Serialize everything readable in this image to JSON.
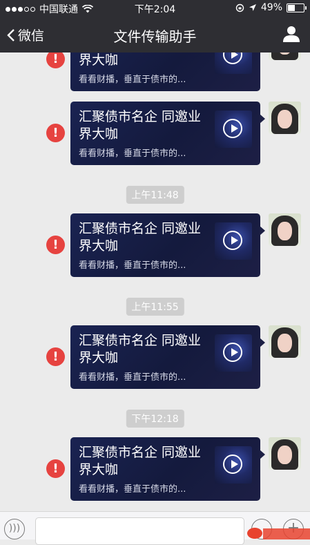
{
  "status_bar": {
    "carrier": "中国联通",
    "time": "下午2:04",
    "battery": "49%",
    "battery_level": 0.49,
    "signal_icon": "signal-dots-icon",
    "wifi_icon": "wifi-icon",
    "location_icon": "location-arrow-icon"
  },
  "nav": {
    "back_label": "微信",
    "title": "文件传输助手",
    "profile_icon": "person-icon"
  },
  "colors": {
    "nav_bg": "#2e2e33",
    "chat_bg": "#ebebeb",
    "error_red": "#e64340",
    "card_bg": "#1a2352"
  },
  "messages": [
    {
      "timestamp": "",
      "title": "汇聚债市名企 同邀业界大咖",
      "description": "看看财播，垂直于债市的...",
      "failed": true
    },
    {
      "timestamp": "",
      "title": "汇聚债市名企 同邀业界大咖",
      "description": "看看财播，垂直于债市的...",
      "failed": true
    },
    {
      "timestamp": "上午11:48",
      "title": "汇聚债市名企 同邀业界大咖",
      "description": "看看财播，垂直于债市的...",
      "failed": true
    },
    {
      "timestamp": "上午11:55",
      "title": "汇聚债市名企 同邀业界大咖",
      "description": "看看财播，垂直于债市的...",
      "failed": true
    },
    {
      "timestamp": "下午12:18",
      "title": "汇聚债市名企 同邀业界大咖",
      "description": "看看财播，垂直于债市的...",
      "failed": true
    }
  ],
  "input_bar": {
    "voice_icon": "voice-icon",
    "emoji_icon": "emoji-icon",
    "plus_icon": "plus-icon",
    "value": ""
  }
}
